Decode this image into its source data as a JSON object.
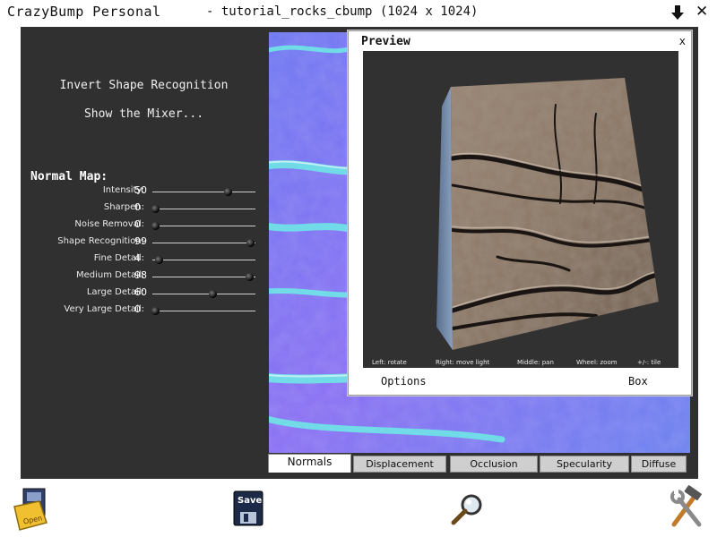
{
  "window": {
    "app_title": "CrazyBump Personal",
    "file_title": "- tutorial_rocks_cbump (1024 x 1024)",
    "download_icon": "down-arrow-icon",
    "close_glyph": "✕"
  },
  "left_panel": {
    "invert_label": "Invert Shape Recognition",
    "mixer_label": "Show the Mixer...",
    "section_title": "Normal Map:",
    "sliders": [
      {
        "label": "Intensity:",
        "value": "50",
        "level": 0.73
      },
      {
        "label": "Sharpen:",
        "value": "0",
        "level": 0.03
      },
      {
        "label": "Noise Removal:",
        "value": "0",
        "level": 0.03
      },
      {
        "label": "Shape Recognition:",
        "value": "99",
        "level": 0.95
      },
      {
        "label": "Fine Detail:",
        "value": "4",
        "level": 0.06
      },
      {
        "label": "Medium Detail:",
        "value": "98",
        "level": 0.94
      },
      {
        "label": "Large Detail:",
        "value": "60",
        "level": 0.58
      },
      {
        "label": "Very Large Detail:",
        "value": "0",
        "level": 0.03
      }
    ]
  },
  "tabs": [
    {
      "label": "Normals",
      "active": true
    },
    {
      "label": "Displacement",
      "active": false
    },
    {
      "label": "Occlusion",
      "active": false
    },
    {
      "label": "Specularity",
      "active": false
    },
    {
      "label": "Diffuse",
      "active": false
    }
  ],
  "preview": {
    "title": "Preview",
    "close_label": "x",
    "hints": [
      "Left: rotate",
      "Right: move light",
      "Middle: pan",
      "Wheel: zoom",
      "+/-: tile"
    ],
    "options_label": "Options",
    "shape_label": "Box"
  },
  "toolbar": {
    "open_label": "Open",
    "save_label": "Save",
    "open_icon": "open-folder-icon",
    "save_icon": "floppy-disk-icon",
    "zoom_icon": "magnifier-icon",
    "tools_icon": "hammer-wrench-icon"
  },
  "colors": {
    "workspace": "#303030",
    "normal_map_base": "#7f6cf2",
    "normal_map_streak": "#63e0e3",
    "rock": "#8b7664"
  }
}
